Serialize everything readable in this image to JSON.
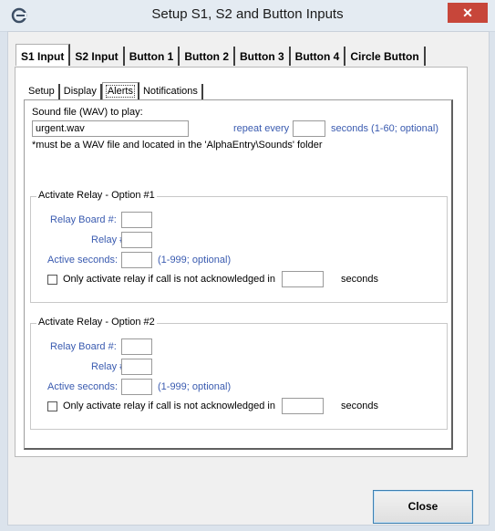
{
  "window": {
    "title": "Setup S1, S2 and Button Inputs",
    "close_glyph": "✕",
    "icon": "alphaentry-logo-icon"
  },
  "main_tabs": [
    {
      "label": "S1 Input",
      "active": true
    },
    {
      "label": "S2 Input",
      "active": false
    },
    {
      "label": "Button 1",
      "active": false
    },
    {
      "label": "Button 2",
      "active": false
    },
    {
      "label": "Button 3",
      "active": false
    },
    {
      "label": "Button 4",
      "active": false
    },
    {
      "label": "Circle Button",
      "active": false
    }
  ],
  "sub_tabs": [
    {
      "label": "Setup",
      "active": false
    },
    {
      "label": "Display",
      "active": false
    },
    {
      "label": "Alerts",
      "active": true
    },
    {
      "label": "Notifications",
      "active": false
    }
  ],
  "sound": {
    "label": "Sound file (WAV) to play:",
    "file_value": "urgent.wav",
    "repeat_label": "repeat every",
    "repeat_value": "",
    "repeat_suffix": "seconds (1-60; optional)",
    "note": "*must be a WAV file and located in the 'AlphaEntry\\Sounds' folder"
  },
  "relay1": {
    "legend": "Activate Relay - Option #1",
    "board_label": "Relay Board #:",
    "board_value": "",
    "relay_label": "Relay #:",
    "relay_value": "",
    "active_label": "Active seconds:",
    "active_value": "",
    "active_hint": "(1-999; optional)",
    "check_label": "Only activate relay if call is not acknowledged in",
    "check_checked": false,
    "ack_value": "",
    "seconds_label": "seconds"
  },
  "relay2": {
    "legend": "Activate Relay - Option #2",
    "board_label": "Relay Board #:",
    "board_value": "",
    "relay_label": "Relay #:",
    "relay_value": "",
    "active_label": "Active seconds:",
    "active_value": "",
    "active_hint": "(1-999; optional)",
    "check_label": "Only activate relay if call is not acknowledged in",
    "check_checked": false,
    "ack_value": "",
    "seconds_label": "seconds"
  },
  "buttons": {
    "close_label": "Close"
  },
  "colors": {
    "label_blue": "#3a5bb0",
    "close_red": "#c7463a",
    "focus_border": "#3c7fb1"
  }
}
